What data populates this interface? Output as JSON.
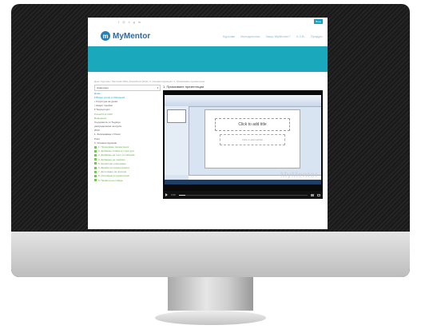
{
  "topbar": {
    "social_icons": [
      "facebook-icon",
      "instagram-icon",
      "vimeo-icon",
      "googleplus-icon",
      "linkedin-icon"
    ],
    "social_glyphs": [
      "f",
      "◎",
      "v",
      "g",
      "in"
    ],
    "login_label": "Вход"
  },
  "header": {
    "logo_mark": "m",
    "logo_text": "MyMentor",
    "logo_mark_char_sup": "®",
    "nav": [
      "Курсове",
      "Методология",
      "Защо MyMentor?",
      "Ч.З.В.",
      "Продукт"
    ]
  },
  "breadcrumb": "Дом / Курсове / Microsoft Office PowerPoint 2010 / 2. Основни функции / 1. Прикачване презентация",
  "sidebar": {
    "dropdown_label": "Навигация",
    "lines": [
      {
        "text": "Дома",
        "style": "link"
      },
      {
        "text": "▾ Видео уроци и обяснения",
        "style": "link"
      },
      {
        "text": "• Структура на урока",
        "style": "plain"
      },
      {
        "text": "• Акаунт профил",
        "style": "plain"
      },
      {
        "text": "▾ Текущи курс",
        "style": "plain"
      },
      {
        "text": "PowerPoint 2010",
        "style": "green"
      },
      {
        "text": "Въведение",
        "style": "green"
      },
      {
        "text": "Съдържа се от бъдещо",
        "style": "plain"
      },
      {
        "text": "разпределение на курса",
        "style": "plain"
      },
      {
        "text": "2010",
        "style": "plain"
      },
      {
        "text": "1. Запознаване с Power",
        "style": "plain"
      },
      {
        "text": "Point",
        "style": "plain"
      },
      {
        "text": "2. Основни функции",
        "style": "plain"
      },
      {
        "text": "1. Прикачване презентация",
        "style": "green-sq"
      },
      {
        "text": "2. Добавяне слайди в структура",
        "style": "green-sq"
      },
      {
        "text": "3. Добавяне на текст в слайдове",
        "style": "green-sq"
      },
      {
        "text": "4. Добавяне на графики",
        "style": "green-sq"
      },
      {
        "text": "5. Шрифтове и вмъкване",
        "style": "green-sq"
      },
      {
        "text": "6. Дизайн на презентацията",
        "style": "green-sq"
      },
      {
        "text": "7. Допълване на преходи",
        "style": "green-sq"
      },
      {
        "text": "8. Изтриване в презентация",
        "style": "green-sq"
      },
      {
        "text": "9. Правила на слайда",
        "style": "green-sq"
      }
    ]
  },
  "lesson": {
    "title": "1. Прикачване презентация",
    "video": {
      "slide_title_placeholder": "Click to add title",
      "slide_subtitle_placeholder": "Click to add subtitle",
      "watermark": "MyMentor",
      "time": "0:00",
      "progress": 0.05
    }
  },
  "colors": {
    "accent": "#1aa8bd",
    "logo": "#2a6aa0"
  }
}
